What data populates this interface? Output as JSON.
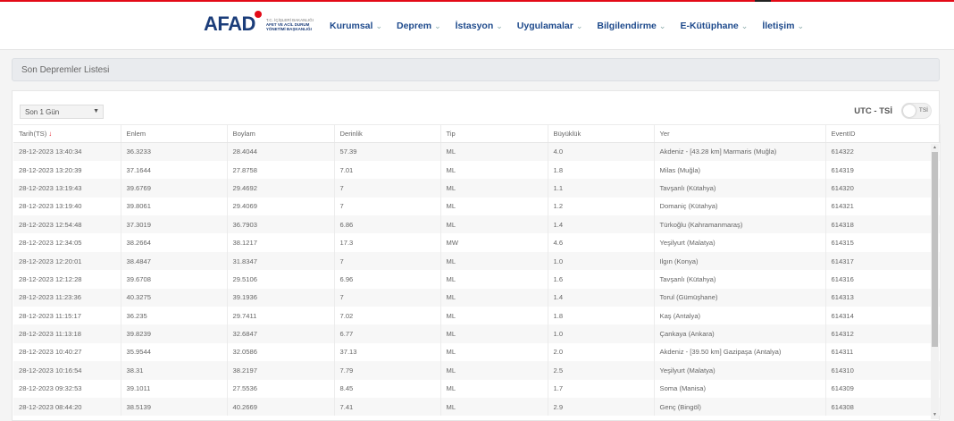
{
  "header": {
    "logo": {
      "text": "AFAD",
      "sub_line1": "T.C. İÇİŞLERİ BAKANLIĞI",
      "sub_line2": "AFET VE ACİL DURUM",
      "sub_line3": "YÖNETİMİ BAŞKANLIĞI"
    },
    "nav": [
      {
        "label": "Kurumsal",
        "icon": "chevron-down-icon"
      },
      {
        "label": "Deprem",
        "icon": "chevron-down-icon"
      },
      {
        "label": "İstasyon",
        "icon": "chevron-down-icon"
      },
      {
        "label": "Uygulamalar",
        "icon": "chevron-down-icon"
      },
      {
        "label": "Bilgilendirme",
        "icon": "chevron-down-icon"
      },
      {
        "label": "E-Kütüphane",
        "icon": "chevron-down-icon"
      },
      {
        "label": "İletişim",
        "icon": "chevron-down-icon"
      }
    ]
  },
  "page": {
    "title": "Son Depremler Listesi"
  },
  "filters": {
    "period_select": "Son 1 Gün",
    "utc_label": "UTC - TSİ",
    "toggle_label": "TSİ"
  },
  "table": {
    "columns": [
      "Tarih(TS)",
      "Enlem",
      "Boylam",
      "Derinlik",
      "Tip",
      "Büyüklük",
      "Yer",
      "EventID"
    ],
    "sort_indicator": "↓",
    "rows": [
      [
        "28-12-2023 13:40:34",
        "36.3233",
        "28.4044",
        "57.39",
        "ML",
        "4.0",
        "Akdeniz - [43.28 km] Marmaris (Muğla)",
        "614322"
      ],
      [
        "28-12-2023 13:20:39",
        "37.1644",
        "27.8758",
        "7.01",
        "ML",
        "1.8",
        "Milas (Muğla)",
        "614319"
      ],
      [
        "28-12-2023 13:19:43",
        "39.6769",
        "29.4692",
        "7",
        "ML",
        "1.1",
        "Tavşanlı (Kütahya)",
        "614320"
      ],
      [
        "28-12-2023 13:19:40",
        "39.8061",
        "29.4069",
        "7",
        "ML",
        "1.2",
        "Domaniç (Kütahya)",
        "614321"
      ],
      [
        "28-12-2023 12:54:48",
        "37.3019",
        "36.7903",
        "6.86",
        "ML",
        "1.4",
        "Türkoğlu (Kahramanmaraş)",
        "614318"
      ],
      [
        "28-12-2023 12:34:05",
        "38.2664",
        "38.1217",
        "17.3",
        "MW",
        "4.6",
        "Yeşilyurt (Malatya)",
        "614315"
      ],
      [
        "28-12-2023 12:20:01",
        "38.4847",
        "31.8347",
        "7",
        "ML",
        "1.0",
        "Ilgın (Konya)",
        "614317"
      ],
      [
        "28-12-2023 12:12:28",
        "39.6708",
        "29.5106",
        "6.96",
        "ML",
        "1.6",
        "Tavşanlı (Kütahya)",
        "614316"
      ],
      [
        "28-12-2023 11:23:36",
        "40.3275",
        "39.1936",
        "7",
        "ML",
        "1.4",
        "Torul (Gümüşhane)",
        "614313"
      ],
      [
        "28-12-2023 11:15:17",
        "36.235",
        "29.7411",
        "7.02",
        "ML",
        "1.8",
        "Kaş (Antalya)",
        "614314"
      ],
      [
        "28-12-2023 11:13:18",
        "39.8239",
        "32.6847",
        "6.77",
        "ML",
        "1.0",
        "Çankaya (Ankara)",
        "614312"
      ],
      [
        "28-12-2023 10:40:27",
        "35.9544",
        "32.0586",
        "37.13",
        "ML",
        "2.0",
        "Akdeniz - [39.50 km] Gazipaşa (Antalya)",
        "614311"
      ],
      [
        "28-12-2023 10:16:54",
        "38.31",
        "38.2197",
        "7.79",
        "ML",
        "2.5",
        "Yeşilyurt (Malatya)",
        "614310"
      ],
      [
        "28-12-2023 09:32:53",
        "39.1011",
        "27.5536",
        "8.45",
        "ML",
        "1.7",
        "Soma (Manisa)",
        "614309"
      ],
      [
        "28-12-2023 08:44:20",
        "38.5139",
        "40.2669",
        "7.41",
        "ML",
        "2.9",
        "Genç (Bingöl)",
        "614308"
      ]
    ]
  },
  "colors": {
    "brand": "#1b3d7a",
    "nav": "#1e4a8c",
    "accent": "#e30a17"
  }
}
